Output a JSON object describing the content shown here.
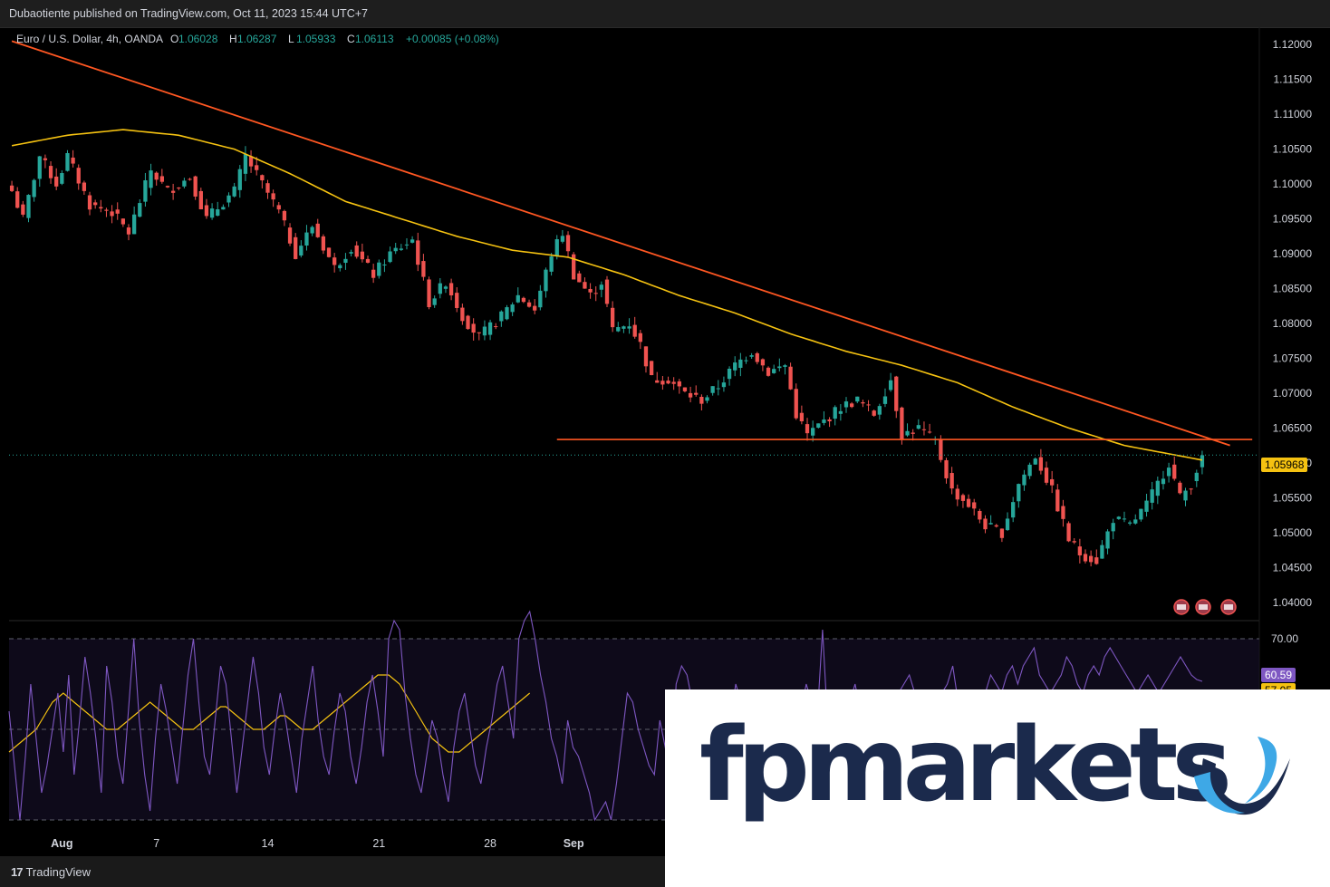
{
  "header": {
    "published": "Dubaotiente published on TradingView.com, Oct 11, 2023 15:44 UTC+7",
    "symbol": "Euro / U.S. Dollar, 4h, OANDA",
    "ohlc": [
      {
        "k": "O",
        "v": "1.06028"
      },
      {
        "k": "H",
        "v": "1.06287"
      },
      {
        "k": "L",
        "v": "1.05933"
      },
      {
        "k": "C",
        "v": "1.06113"
      }
    ],
    "change": "+0.00085 (+0.08%)"
  },
  "footer": {
    "brand": "TradingView",
    "logo_glyph": "17"
  },
  "watermark": {
    "text": "fpmarkets",
    "colors": {
      "text": "#1b2a4c",
      "mark_dark": "#1b2a4c",
      "mark_light": "#3ea8e6"
    }
  },
  "colors": {
    "up": "#26a69a",
    "down": "#ef5350",
    "ma": "#f5c211",
    "trend": "#ff5722",
    "rsi": "#7e57c2",
    "rsi_ma": "#f5c211",
    "grid": "#1e1e1e"
  },
  "chart_data": [
    {
      "type": "candlestick",
      "title": "Euro / U.S. Dollar, 4h, OANDA",
      "x_labels": [
        {
          "label": "Aug",
          "bar": 9
        },
        {
          "label": "7",
          "bar": 26
        },
        {
          "label": "14",
          "bar": 46
        },
        {
          "label": "21",
          "bar": 66
        },
        {
          "label": "28",
          "bar": 86
        },
        {
          "label": "Sep",
          "bar": 101
        }
      ],
      "bars_total": 215,
      "ylim": [
        1.0375,
        1.1225
      ],
      "yticks": [
        "1.12000",
        "1.11500",
        "1.11000",
        "1.10500",
        "1.10000",
        "1.09500",
        "1.09000",
        "1.08500",
        "1.08000",
        "1.07500",
        "1.07000",
        "1.06500",
        "1.06000",
        "1.05500",
        "1.05000",
        "1.04500",
        "1.04000"
      ],
      "price_anchors": [
        [
          0,
          1.099
        ],
        [
          2,
          1.095
        ],
        [
          5,
          1.104
        ],
        [
          8,
          1.1
        ],
        [
          10,
          1.104
        ],
        [
          14,
          1.097
        ],
        [
          18,
          1.096
        ],
        [
          21,
          1.093
        ],
        [
          25,
          1.102
        ],
        [
          28,
          1.099
        ],
        [
          32,
          1.101
        ],
        [
          35,
          1.095
        ],
        [
          40,
          1.099
        ],
        [
          42,
          1.104
        ],
        [
          45,
          1.1
        ],
        [
          48,
          1.096
        ],
        [
          51,
          1.09
        ],
        [
          54,
          1.094
        ],
        [
          58,
          1.088
        ],
        [
          61,
          1.091
        ],
        [
          65,
          1.087
        ],
        [
          68,
          1.09
        ],
        [
          72,
          1.092
        ],
        [
          75,
          1.083
        ],
        [
          78,
          1.086
        ],
        [
          81,
          1.081
        ],
        [
          84,
          1.078
        ],
        [
          88,
          1.081
        ],
        [
          91,
          1.084
        ],
        [
          94,
          1.082
        ],
        [
          97,
          1.09
        ],
        [
          99,
          1.093
        ],
        [
          101,
          1.087
        ],
        [
          104,
          1.084
        ],
        [
          106,
          1.086
        ],
        [
          108,
          1.079
        ],
        [
          111,
          1.08
        ],
        [
          113,
          1.077
        ],
        [
          115,
          1.072
        ],
        [
          118,
          1.072
        ],
        [
          121,
          1.07
        ],
        [
          124,
          1.069
        ],
        [
          127,
          1.071
        ],
        [
          130,
          1.074
        ],
        [
          133,
          1.076
        ],
        [
          136,
          1.073
        ],
        [
          139,
          1.074
        ],
        [
          141,
          1.067
        ],
        [
          143,
          1.064
        ],
        [
          146,
          1.066
        ],
        [
          149,
          1.068
        ],
        [
          152,
          1.069
        ],
        [
          155,
          1.067
        ],
        [
          158,
          1.072
        ],
        [
          160,
          1.064
        ],
        [
          163,
          1.065
        ],
        [
          166,
          1.063
        ],
        [
          169,
          1.056
        ],
        [
          172,
          1.054
        ],
        [
          175,
          1.051
        ],
        [
          178,
          1.05
        ],
        [
          181,
          1.057
        ],
        [
          184,
          1.061
        ],
        [
          187,
          1.056
        ],
        [
          190,
          1.049
        ],
        [
          192,
          1.047
        ],
        [
          195,
          1.046
        ],
        [
          198,
          1.052
        ],
        [
          201,
          1.051
        ],
        [
          204,
          1.054
        ],
        [
          206,
          1.057
        ],
        [
          208,
          1.06
        ],
        [
          210,
          1.055
        ],
        [
          212,
          1.057
        ],
        [
          214,
          1.0611
        ]
      ],
      "ma_anchors": [
        [
          0,
          1.1055
        ],
        [
          10,
          1.107
        ],
        [
          20,
          1.1078
        ],
        [
          30,
          1.107
        ],
        [
          40,
          1.105
        ],
        [
          50,
          1.1015
        ],
        [
          60,
          1.0975
        ],
        [
          70,
          1.095
        ],
        [
          80,
          1.0925
        ],
        [
          90,
          1.0905
        ],
        [
          100,
          1.0895
        ],
        [
          110,
          1.087
        ],
        [
          120,
          1.084
        ],
        [
          130,
          1.0815
        ],
        [
          140,
          1.0785
        ],
        [
          150,
          1.076
        ],
        [
          160,
          1.074
        ],
        [
          170,
          1.0715
        ],
        [
          180,
          1.068
        ],
        [
          190,
          1.065
        ],
        [
          200,
          1.0625
        ],
        [
          214,
          1.0604
        ]
      ],
      "trendline": {
        "from": [
          0,
          1.1205
        ],
        "to": [
          219,
          1.0625
        ]
      },
      "horizontal_line": {
        "from_bar": 98,
        "to_bar": 223,
        "price": 1.06335
      },
      "last_price": 1.06113,
      "price_label": "1.05968"
    },
    {
      "type": "line",
      "title": "RSI",
      "ylim": [
        27,
        73
      ],
      "levels": [
        70,
        50,
        30
      ],
      "yticks": [
        "70.00"
      ],
      "series": [
        {
          "values": [
            54,
            42,
            30,
            44,
            60,
            48,
            36,
            42,
            50,
            58,
            45,
            62,
            40,
            52,
            66,
            58,
            48,
            36,
            64,
            56,
            44,
            38,
            54,
            70,
            52,
            40,
            32,
            48,
            60,
            54,
            46,
            38,
            50,
            62,
            70,
            56,
            44,
            40,
            52,
            64,
            60,
            48,
            36,
            46,
            56,
            66,
            58,
            46,
            40,
            50,
            58,
            52,
            44,
            36,
            48,
            56,
            64,
            52,
            44,
            40,
            50,
            58,
            54,
            44,
            38,
            46,
            56,
            62,
            54,
            44,
            70,
            74,
            72,
            58,
            48,
            40,
            36,
            44,
            52,
            48,
            40,
            34,
            46,
            54,
            58,
            50,
            42,
            38,
            46,
            52,
            60,
            64,
            56,
            48,
            70,
            74,
            76,
            70,
            62,
            56,
            48,
            44,
            38,
            52,
            46,
            44,
            40,
            36,
            30,
            32,
            34,
            30,
            38,
            48,
            58,
            56,
            50,
            46,
            42,
            40,
            52,
            46,
            38,
            60,
            64,
            62,
            56,
            50,
            58,
            54,
            44,
            36,
            42,
            52,
            60,
            56,
            48,
            42,
            38,
            46,
            50,
            44,
            40,
            36,
            42,
            48,
            54,
            60,
            56,
            52,
            72,
            50,
            46,
            50,
            54,
            56,
            60,
            54,
            50,
            48,
            46,
            42,
            48,
            54,
            58,
            60,
            62,
            58,
            56,
            54,
            50,
            52,
            58,
            60,
            64,
            56,
            50,
            48,
            52,
            56,
            58,
            62,
            60,
            58,
            62,
            64,
            60,
            64,
            66,
            68,
            62,
            60,
            58,
            60,
            62,
            66,
            64,
            60,
            58,
            62,
            64,
            62,
            66,
            68,
            66,
            64,
            62,
            60,
            58,
            60,
            62,
            60,
            58,
            60,
            62,
            64,
            66,
            64,
            62,
            61,
            60.59
          ]
        },
        {
          "values_ma": [
            45,
            46,
            47,
            48,
            49,
            50,
            52,
            54,
            56,
            57,
            58,
            57,
            56,
            55,
            54,
            53,
            52,
            51,
            50,
            50,
            50,
            51,
            52,
            53,
            54,
            55,
            56,
            55,
            54,
            53,
            52,
            51,
            50,
            50,
            50,
            51,
            52,
            53,
            54,
            55,
            55,
            54,
            53,
            52,
            51,
            50,
            50,
            50,
            51,
            52,
            53,
            53,
            52,
            51,
            50,
            50,
            50,
            51,
            52,
            53,
            54,
            55,
            56,
            57,
            58,
            59,
            60,
            61,
            62,
            62,
            62,
            61,
            60,
            58,
            56,
            54,
            52,
            50,
            48,
            47,
            46,
            45,
            45,
            45,
            46,
            47,
            48,
            49,
            50,
            51,
            52,
            53,
            54,
            55,
            56,
            57,
            58
          ]
        }
      ],
      "value_label": "60.59",
      "ma_label": "57.05"
    }
  ]
}
